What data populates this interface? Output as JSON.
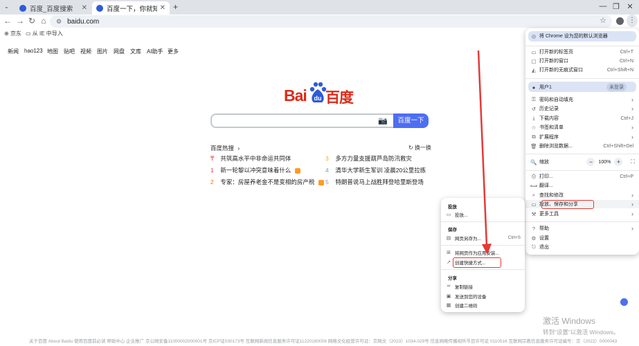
{
  "tabs": [
    {
      "title": "百度_百度搜索",
      "active": false
    },
    {
      "title": "百度一下，你就知道",
      "active": true
    }
  ],
  "tab_new": "+",
  "window": {
    "minimize": "—",
    "restore": "❐",
    "close": "✕"
  },
  "omnibox": {
    "url": "baidu.com"
  },
  "bookmarks": {
    "all_label": "京东",
    "import_label": "从 IE 中导入"
  },
  "baidu": {
    "nav": [
      "新闻",
      "hao123",
      "地图",
      "贴吧",
      "视频",
      "图片",
      "网盘",
      "文库",
      "AI助手",
      "更多"
    ],
    "logo_left": "Bai",
    "logo_paw": "du",
    "logo_right": "百度",
    "search_button": "百度一下",
    "hot_title": "百度热搜",
    "hot_refresh": "换一换",
    "hot_items": [
      {
        "idx": "",
        "text": "共筑高水平中非命运共同体",
        "badge": false
      },
      {
        "idx": "3",
        "text": "多方力量支援葫芦岛防汛救灾",
        "badge": false
      },
      {
        "idx": "1",
        "text": "新一轮黎以冲突意味着什么",
        "badge": true
      },
      {
        "idx": "4",
        "text": "清华大学新生军训 凌晨20公里拉练",
        "badge": false
      },
      {
        "idx": "2",
        "text": "专家：房屋养老金不是变相的房产税",
        "badge": true
      },
      {
        "idx": "5",
        "text": "特朗普说马上战胜拜登哈里斯登场",
        "badge": false
      }
    ],
    "footer": "关于百度   About Baidu   使用百度前必读   帮助中心   企业推广   京公网安备11000002000001号   京ICP证030173号   互联网新闻信息服务许可证11220180008   网络文化经营许可证：京网文〔2023〕1034-029号   信息网络传播视听节目许可证 0110516   互联网宗教信息服务许可证编号：京（2022）0000043"
  },
  "watermark": {
    "line1": "激活 Windows",
    "line2": "转到“设置”以激活 Windows。"
  },
  "chrome_menu": {
    "default_browser": "将 Chrome 设为您的默认浏览器",
    "new_tab": {
      "label": "打开新的标签页",
      "shortcut": "Ctrl+T"
    },
    "new_window": {
      "label": "打开新的窗口",
      "shortcut": "Ctrl+N"
    },
    "incognito": {
      "label": "打开新的无痕式窗口",
      "shortcut": "Ctrl+Shift+N"
    },
    "profile": {
      "label": "用户1",
      "status": "未登录"
    },
    "passwords": "密码和自动填充",
    "history": "历史记录",
    "downloads": {
      "label": "下载内容",
      "shortcut": "Ctrl+J"
    },
    "bookmarks": "书签和清单",
    "extensions": "扩展程序",
    "clear_data": {
      "label": "删除浏览数据...",
      "shortcut": "Ctrl+Shift+Del"
    },
    "zoom": {
      "label": "缩放",
      "minus": "−",
      "value": "100%",
      "plus": "+"
    },
    "print": {
      "label": "打印...",
      "shortcut": "Ctrl+P"
    },
    "translate": "翻译...",
    "find": "查找和修改",
    "cast_save_share": "投放、保存和分享",
    "more_tools": "更多工具",
    "help": "帮助",
    "settings": "设置",
    "exit": "退出"
  },
  "sub_menu": {
    "cast_header": "投放",
    "cast": "投放...",
    "save_header": "保存",
    "save_page": {
      "label": "网页另存为...",
      "shortcut": "Ctrl+S"
    },
    "install_app": "将网页作为应用安装...",
    "create_shortcut": "创建快捷方式...",
    "share_header": "分享",
    "copy_link": "复制链接",
    "send_devices": "发送到您的设备",
    "qr_code": "创建二维码"
  },
  "colors": {
    "accent": "#4e6ef2",
    "baidu_red": "#de2a1a",
    "annotation": "#e53935"
  }
}
